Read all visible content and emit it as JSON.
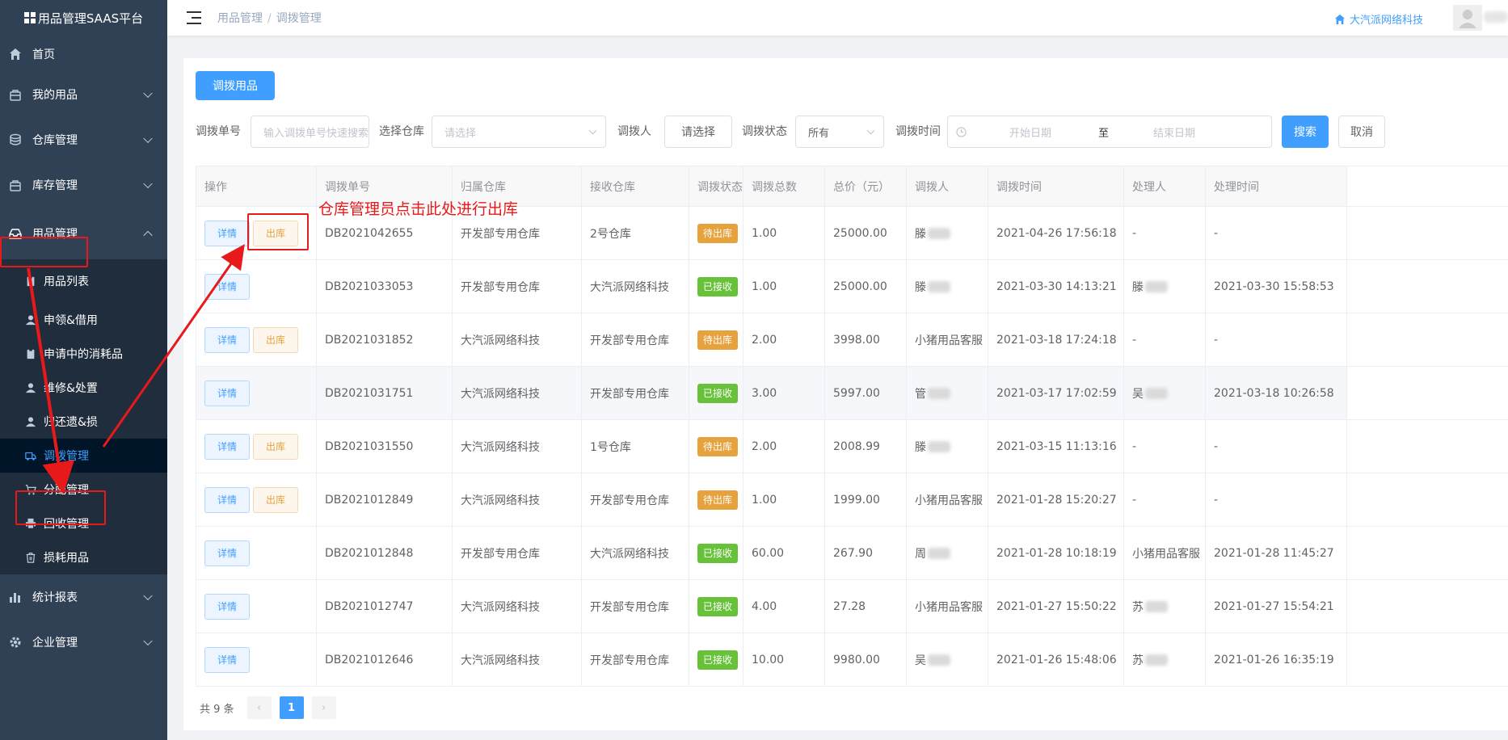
{
  "sidebar": {
    "logo": "用品管理SAAS平台",
    "menu": [
      {
        "label": "首页",
        "icon": "home-icon"
      },
      {
        "label": "我的用品",
        "icon": "bag-icon"
      },
      {
        "label": "仓库管理",
        "icon": "database-icon"
      },
      {
        "label": "库存管理",
        "icon": "bag-icon"
      },
      {
        "label": "用品管理",
        "icon": "inbox-icon"
      }
    ],
    "submenu": [
      {
        "label": "用品列表",
        "icon": "clipboard-icon"
      },
      {
        "label": "申领&借用",
        "icon": "user-icon"
      },
      {
        "label": "申请中的消耗品",
        "icon": "clipboard-icon"
      },
      {
        "label": "维修&处置",
        "icon": "user-icon"
      },
      {
        "label": "归还遗&损",
        "icon": "user-icon"
      },
      {
        "label": "调拨管理",
        "icon": "truck-icon"
      },
      {
        "label": "分配管理",
        "icon": "cart-icon"
      },
      {
        "label": "回收管理",
        "icon": "printer-icon"
      },
      {
        "label": "损耗用品",
        "icon": "trash-icon"
      }
    ],
    "menu_bottom": [
      {
        "label": "统计报表",
        "icon": "bar-chart-icon"
      },
      {
        "label": "企业管理",
        "icon": "gear-icon"
      }
    ]
  },
  "header": {
    "breadcrumb": [
      "用品管理",
      "调拨管理"
    ],
    "breadcrumb_sep": "/",
    "company": "大汽派网络科技"
  },
  "main": {
    "transfer_button": "调拨用品",
    "filters": {
      "order_no_label": "调拨单号",
      "order_no_placeholder": "输入调拨单号快速搜索",
      "warehouse_label": "选择仓库",
      "warehouse_placeholder": "请选择",
      "person_label": "调拨人",
      "person_button": "请选择",
      "status_label": "调拨状态",
      "status_value": "所有",
      "time_label": "调拨时间",
      "start_placeholder": "开始日期",
      "to": "至",
      "end_placeholder": "结束日期",
      "search_button": "搜索",
      "cancel_button": "取消"
    },
    "table": {
      "headers": [
        "操作",
        "调拨单号",
        "归属仓库",
        "接收仓库",
        "调拨状态",
        "调拨总数",
        "总价（元）",
        "调拨人",
        "调拨时间",
        "处理人",
        "处理时间"
      ],
      "detail_label": "详情",
      "out_label": "出库",
      "rows": [
        {
          "no": "DB2021042655",
          "from": "开发部专用仓库",
          "to": "2号仓库",
          "status": "待出库",
          "qty": "1.00",
          "price": "25000.00",
          "person": "滕",
          "time": "2021-04-26 17:56:18",
          "handler": "-",
          "handled": "-"
        },
        {
          "no": "DB2021033053",
          "from": "开发部专用仓库",
          "to": "大汽派网络科技",
          "status": "已接收",
          "qty": "1.00",
          "price": "25000.00",
          "person": "滕",
          "time": "2021-03-30 14:13:21",
          "handler": "滕",
          "handled": "2021-03-30 15:58:53"
        },
        {
          "no": "DB2021031852",
          "from": "大汽派网络科技",
          "to": "开发部专用仓库",
          "status": "待出库",
          "qty": "2.00",
          "price": "3998.00",
          "person": "小猪用品客服",
          "time": "2021-03-18 17:24:18",
          "handler": "-",
          "handled": "-"
        },
        {
          "no": "DB2021031751",
          "from": "大汽派网络科技",
          "to": "开发部专用仓库",
          "status": "已接收",
          "qty": "3.00",
          "price": "5997.00",
          "person": "管",
          "time": "2021-03-17 17:02:59",
          "handler": "吴",
          "handled": "2021-03-18 10:26:58"
        },
        {
          "no": "DB2021031550",
          "from": "大汽派网络科技",
          "to": "1号仓库",
          "status": "待出库",
          "qty": "2.00",
          "price": "2008.99",
          "person": "滕",
          "time": "2021-03-15 11:13:16",
          "handler": "-",
          "handled": "-"
        },
        {
          "no": "DB2021012849",
          "from": "大汽派网络科技",
          "to": "开发部专用仓库",
          "status": "待出库",
          "qty": "1.00",
          "price": "1999.00",
          "person": "小猪用品客服",
          "time": "2021-01-28 15:20:27",
          "handler": "-",
          "handled": "-"
        },
        {
          "no": "DB2021012848",
          "from": "开发部专用仓库",
          "to": "大汽派网络科技",
          "status": "已接收",
          "qty": "60.00",
          "price": "267.90",
          "person": "周",
          "time": "2021-01-28 10:18:19",
          "handler": "小猪用品客服",
          "handled": "2021-01-28 11:45:27"
        },
        {
          "no": "DB2021012747",
          "from": "大汽派网络科技",
          "to": "开发部专用仓库",
          "status": "已接收",
          "qty": "4.00",
          "price": "27.28",
          "person": "小猪用品客服",
          "time": "2021-01-27 15:50:22",
          "handler": "苏",
          "handled": "2021-01-27 15:54:21"
        },
        {
          "no": "DB2021012646",
          "from": "大汽派网络科技",
          "to": "开发部专用仓库",
          "status": "已接收",
          "qty": "10.00",
          "price": "9980.00",
          "person": "吴",
          "time": "2021-01-26 15:48:06",
          "handler": "苏",
          "handled": "2021-01-26 16:35:19"
        }
      ]
    },
    "pager": {
      "total": "共 9 条",
      "page": "1",
      "prev": "‹",
      "next": "›"
    }
  },
  "annotation": {
    "text": "仓库管理员点击此处进行出库",
    "color": "#e8191a"
  },
  "colors": {
    "sidebar": "#304156",
    "primary": "#409eff",
    "warning": "#e6a23c",
    "success": "#67c23a"
  }
}
